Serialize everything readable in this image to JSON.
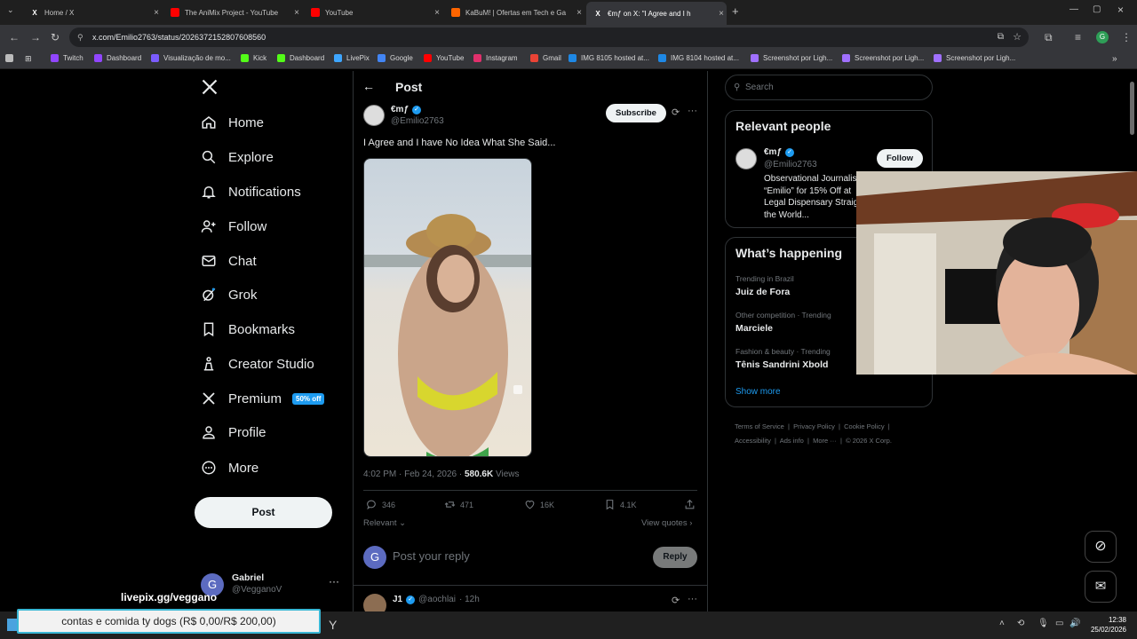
{
  "browser": {
    "tabs": [
      {
        "title": "Home / X",
        "favicon": "x-icon"
      },
      {
        "title": "The AniMix Project - YouTube",
        "favicon": "youtube-icon"
      },
      {
        "title": "YouTube",
        "favicon": "youtube-icon"
      },
      {
        "title": "KaBuM! | Ofertas em Tech e Ga",
        "favicon": "kabum-icon"
      },
      {
        "title": "€mƒ on X: \"I Agree and I h",
        "favicon": "x-icon"
      }
    ],
    "url": "x.com/Emilio2763/status/2026372152807608560",
    "bookmarks": [
      "Twitch",
      "Dashboard",
      "Visualização de mo...",
      "Kick",
      "Dashboard",
      "LivePix",
      "Google",
      "YouTube",
      "Instagram",
      "Gmail",
      "IMG 8105 hosted at...",
      "IMG 8104 hosted at...",
      "Screenshot por Ligh...",
      "Screenshot por Ligh...",
      "Screenshot por Ligh..."
    ],
    "colors": {
      "chrome": "#35363a",
      "tabbar": "#1f1f1f"
    }
  },
  "sidebar": {
    "logo": "x-logo",
    "items": [
      {
        "label": "Home",
        "icon": "home-icon"
      },
      {
        "label": "Explore",
        "icon": "search-icon"
      },
      {
        "label": "Notifications",
        "icon": "bell-icon"
      },
      {
        "label": "Follow",
        "icon": "person-plus-icon"
      },
      {
        "label": "Chat",
        "icon": "mail-icon"
      },
      {
        "label": "Grok",
        "icon": "grok-icon"
      },
      {
        "label": "Bookmarks",
        "icon": "bookmark-icon"
      },
      {
        "label": "Creator Studio",
        "icon": "creator-icon"
      },
      {
        "label": "Premium",
        "icon": "x-icon",
        "badge": "50% off"
      },
      {
        "label": "Profile",
        "icon": "person-icon"
      },
      {
        "label": "More",
        "icon": "more-circle-icon"
      }
    ],
    "post_button": "Post",
    "account": {
      "name": "Gabriel",
      "handle": "@VegganoV",
      "avatar_letter": "G"
    }
  },
  "post": {
    "header_title": "Post",
    "author_name": "€mƒ",
    "author_handle": "@Emilio2763",
    "subscribe_label": "Subscribe",
    "text": "I Agree and I have No Idea What She Said...",
    "time": "4:02 PM · Feb 24, 2026 · ",
    "views_count": "580.6K",
    "views_label": " Views",
    "stats": {
      "replies": "346",
      "reposts": "471",
      "likes": "16K",
      "bookmarks": "4.1K"
    },
    "sort_label": "Relevant",
    "view_quotes": "View quotes",
    "reply_placeholder": "Post your reply",
    "reply_button": "Reply",
    "reply_avatar_letter": "G",
    "next_reply": {
      "name": "J1",
      "handle": "@aochlai",
      "time": "· 12h"
    }
  },
  "right": {
    "search_placeholder": "Search",
    "relevant_title": "Relevant people",
    "person": {
      "name": "€mƒ",
      "handle": "@Emilio2763",
      "follow_label": "Follow",
      "bio": [
        "Observational Journalist",
        "“Emilio” for 15% Off at",
        "Legal Dispensary Straig",
        "the World..."
      ]
    },
    "happening_title": "What’s happening",
    "trends": [
      {
        "category": "Trending in Brazil",
        "name": "Juiz de Fora"
      },
      {
        "category": "Other competition · Trending",
        "name": "Marciele"
      },
      {
        "category": "Fashion & beauty · Trending",
        "name": "Tênis Sandrini Xbold"
      }
    ],
    "show_more": "Show more",
    "footer_row1": [
      "Terms of Service",
      "Privacy Policy",
      "Cookie Policy"
    ],
    "footer_row2": [
      "Accessibility",
      "Ads info",
      "More ···",
      "© 2026 X Corp."
    ]
  },
  "overlay": {
    "livepix": "livepix.gg/veggano",
    "goal_text": "contas e comida ty dogs (R$ 0,00/R$ 200,00)",
    "goal_progress": 0
  },
  "taskbar": {
    "time": "12:38",
    "date": "25/02/2026"
  },
  "accent": "#1d9bf0"
}
